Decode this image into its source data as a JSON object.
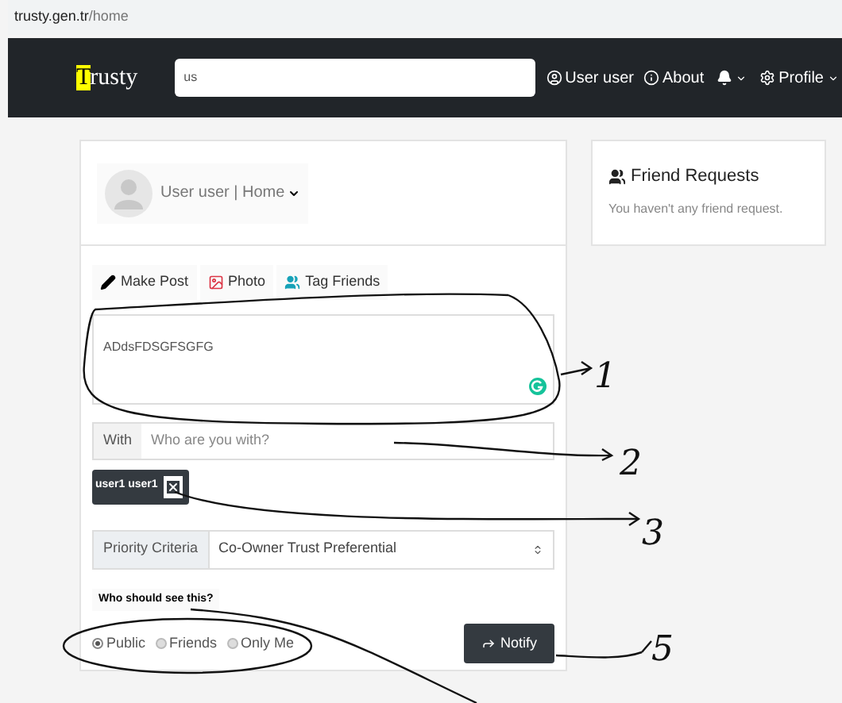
{
  "address_bar": {
    "host": "trusty.gen.tr",
    "path": "/home"
  },
  "navbar": {
    "logo": {
      "highlight": "T",
      "rest": "rusty"
    },
    "search": {
      "value": "us"
    },
    "user": "User user",
    "about": "About",
    "profile": "Profile"
  },
  "profile_header": {
    "text": "User user | Home"
  },
  "friend_requests": {
    "title": "Friend Requests",
    "message": "You haven't any friend request."
  },
  "post_tabs": [
    {
      "kind": "post",
      "label": "Make Post"
    },
    {
      "kind": "photo",
      "label": "Photo"
    },
    {
      "kind": "tag",
      "label": "Tag Friends"
    }
  ],
  "post_text": {
    "value": "ADdsFDSGFSGFG"
  },
  "with": {
    "label": "With",
    "placeholder": "Who are you with?"
  },
  "tagged": [
    {
      "name": "user1 user1"
    }
  ],
  "priority": {
    "label": "Priority Criteria",
    "value": "Co-Owner Trust Preferential"
  },
  "audience": {
    "title": "Who should see this?",
    "options": [
      {
        "label": "Public",
        "selected": true
      },
      {
        "label": "Friends",
        "selected": false
      },
      {
        "label": "Only Me",
        "selected": false
      }
    ]
  },
  "notify_button": "Notify",
  "annotations": [
    {
      "label": "1"
    },
    {
      "label": "2"
    },
    {
      "label": "3"
    },
    {
      "label": "5"
    }
  ]
}
